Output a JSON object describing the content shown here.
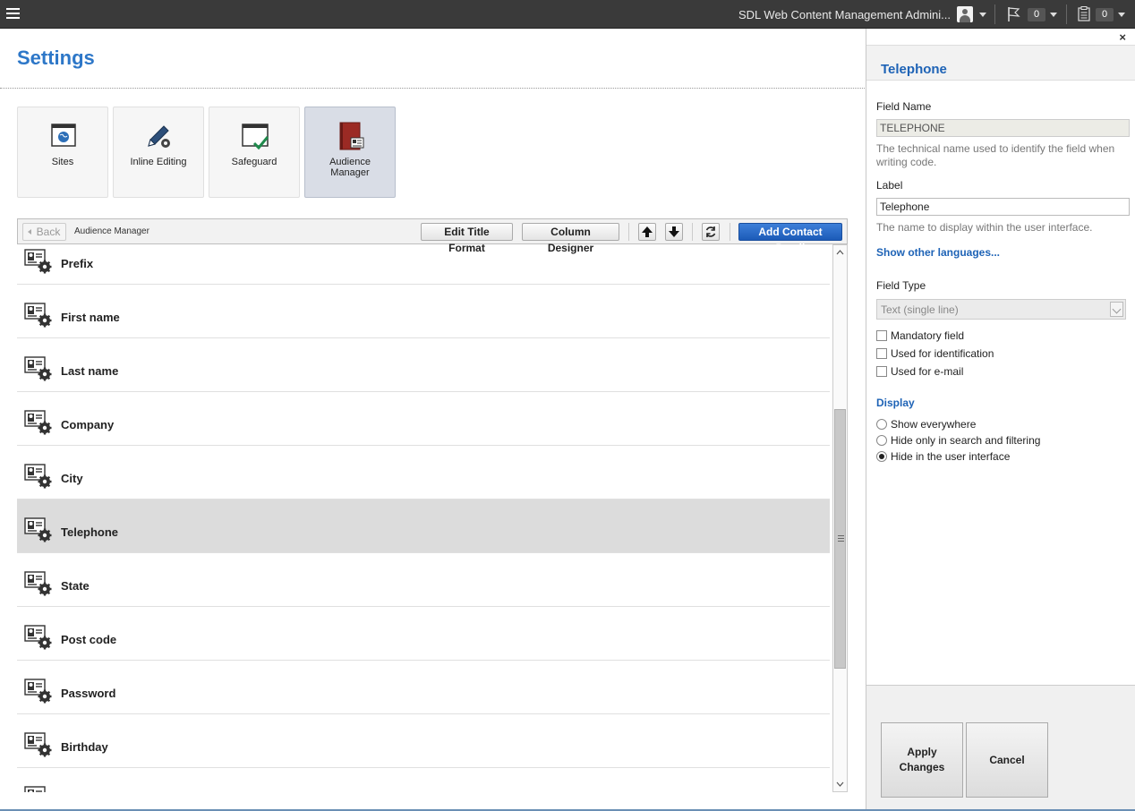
{
  "topbar": {
    "app_title": "SDL Web Content Management Admini...",
    "notifications_count": "0",
    "tasks_count": "0"
  },
  "page": {
    "title": "Settings"
  },
  "tiles": [
    {
      "label": "Sites"
    },
    {
      "label": "Inline Editing"
    },
    {
      "label": "Safeguard"
    },
    {
      "label": "Audience\nManager"
    }
  ],
  "toolbar": {
    "back_label": "Back",
    "breadcrumb": "Audience Manager",
    "edit_title_format": "Edit Title Format",
    "column_designer": "Column Designer",
    "add_contact_detail": "Add Contact Detail"
  },
  "list": {
    "items": [
      "Prefix",
      "First name",
      "Last name",
      "Company",
      "City",
      "Telephone",
      "State",
      "Post code",
      "Password",
      "Birthday"
    ],
    "selected": "Telephone"
  },
  "panel": {
    "title": "Telephone",
    "field_name_label": "Field Name",
    "field_name_value": "TELEPHONE",
    "field_name_help": "The technical name used to identify the field when writing code.",
    "label_label": "Label",
    "label_value": "Telephone",
    "label_help": "The name to display within the user interface.",
    "show_other_languages": "Show other languages...",
    "field_type_label": "Field Type",
    "field_type_value": "Text (single line)",
    "mandatory": "Mandatory field",
    "identification": "Used for identification",
    "email": "Used for e-mail",
    "display_heading": "Display",
    "display_options": [
      "Show everywhere",
      "Hide only in search and filtering",
      "Hide in the user interface"
    ],
    "display_selected": "Hide in the user interface",
    "apply_changes": "Apply\nChanges",
    "cancel": "Cancel"
  },
  "colors": {
    "accent": "#2d77c8",
    "primary_button": "#1c5bb8",
    "topbar": "#3a3a3a"
  }
}
